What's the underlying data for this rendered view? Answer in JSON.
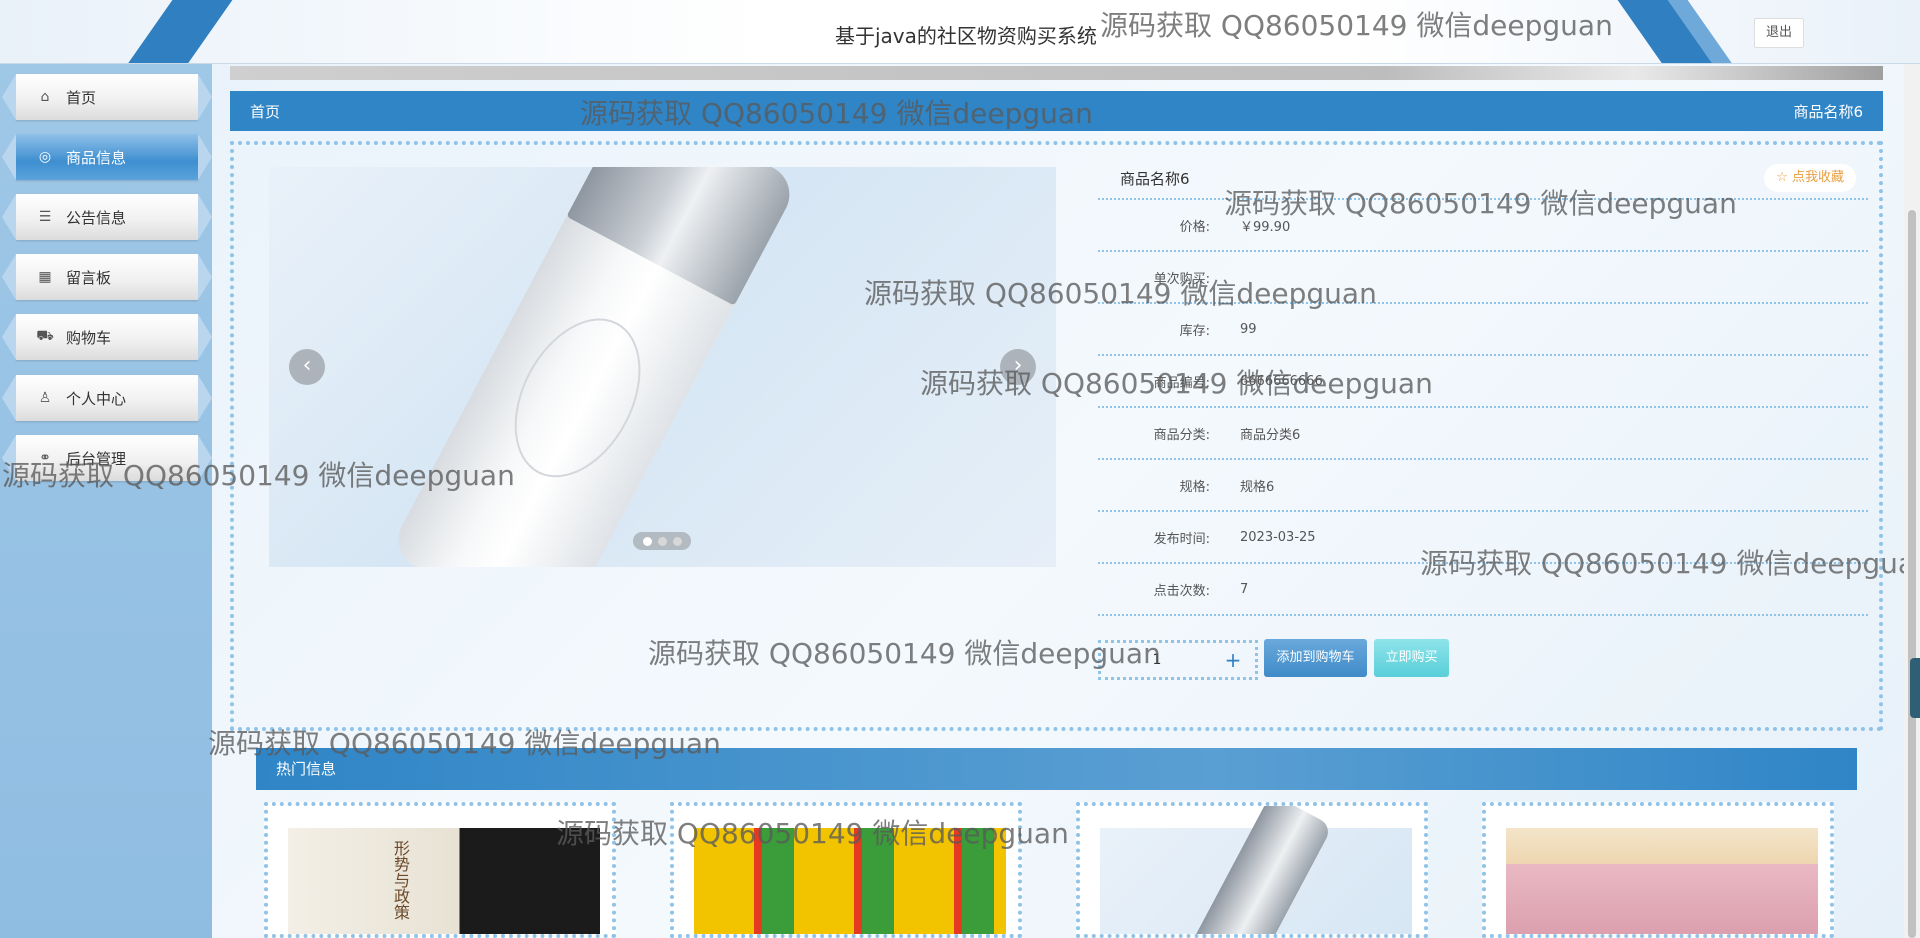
{
  "header": {
    "site_title": "基于java的社区物资购买系统",
    "logout_label": "退出"
  },
  "sidebar": {
    "items": [
      {
        "label": "首页",
        "icon": "home-icon",
        "glyph": "⌂",
        "active": false
      },
      {
        "label": "商品信息",
        "icon": "palette-icon",
        "glyph": "◎",
        "active": true
      },
      {
        "label": "公告信息",
        "icon": "sliders-icon",
        "glyph": "☰",
        "active": false
      },
      {
        "label": "留言板",
        "icon": "calendar-icon",
        "glyph": "▦",
        "active": false
      },
      {
        "label": "购物车",
        "icon": "cart-icon",
        "glyph": "⛟",
        "active": false
      },
      {
        "label": "个人中心",
        "icon": "user-icon",
        "glyph": "♙",
        "active": false
      },
      {
        "label": "后台管理",
        "icon": "link-icon",
        "glyph": "⚭",
        "active": false
      }
    ]
  },
  "breadcrumb": {
    "home": "首页",
    "current": "商品名称6"
  },
  "carousel": {
    "prev_glyph": "‹",
    "next_glyph": "›",
    "slide_count": 3,
    "active_index": 0
  },
  "product": {
    "name": "商品名称6",
    "favorite_label": "☆ 点我收藏",
    "fields": [
      {
        "label": "价格:",
        "value": "￥99.90"
      },
      {
        "label": "单次购买:",
        "value": ""
      },
      {
        "label": "库存:",
        "value": "99"
      },
      {
        "label": "商品编号:",
        "value": "6666666666"
      },
      {
        "label": "商品分类:",
        "value": "商品分类6"
      },
      {
        "label": "规格:",
        "value": "规格6"
      },
      {
        "label": "发布时间:",
        "value": "2023-03-25"
      },
      {
        "label": "点击次数:",
        "value": "7"
      }
    ]
  },
  "purchase": {
    "quantity": "1",
    "plus_label": "+",
    "add_to_cart_label": "添加到购物车",
    "buy_now_label": "立即购买"
  },
  "hot": {
    "title": "热门信息",
    "book_text": "形势与政策"
  },
  "watermark": {
    "text": "源码获取 QQ86050149 微信deepguan"
  },
  "colors": {
    "primary": "#2f85c6",
    "favorite": "#e8a041",
    "buy": "#59cfd9"
  }
}
